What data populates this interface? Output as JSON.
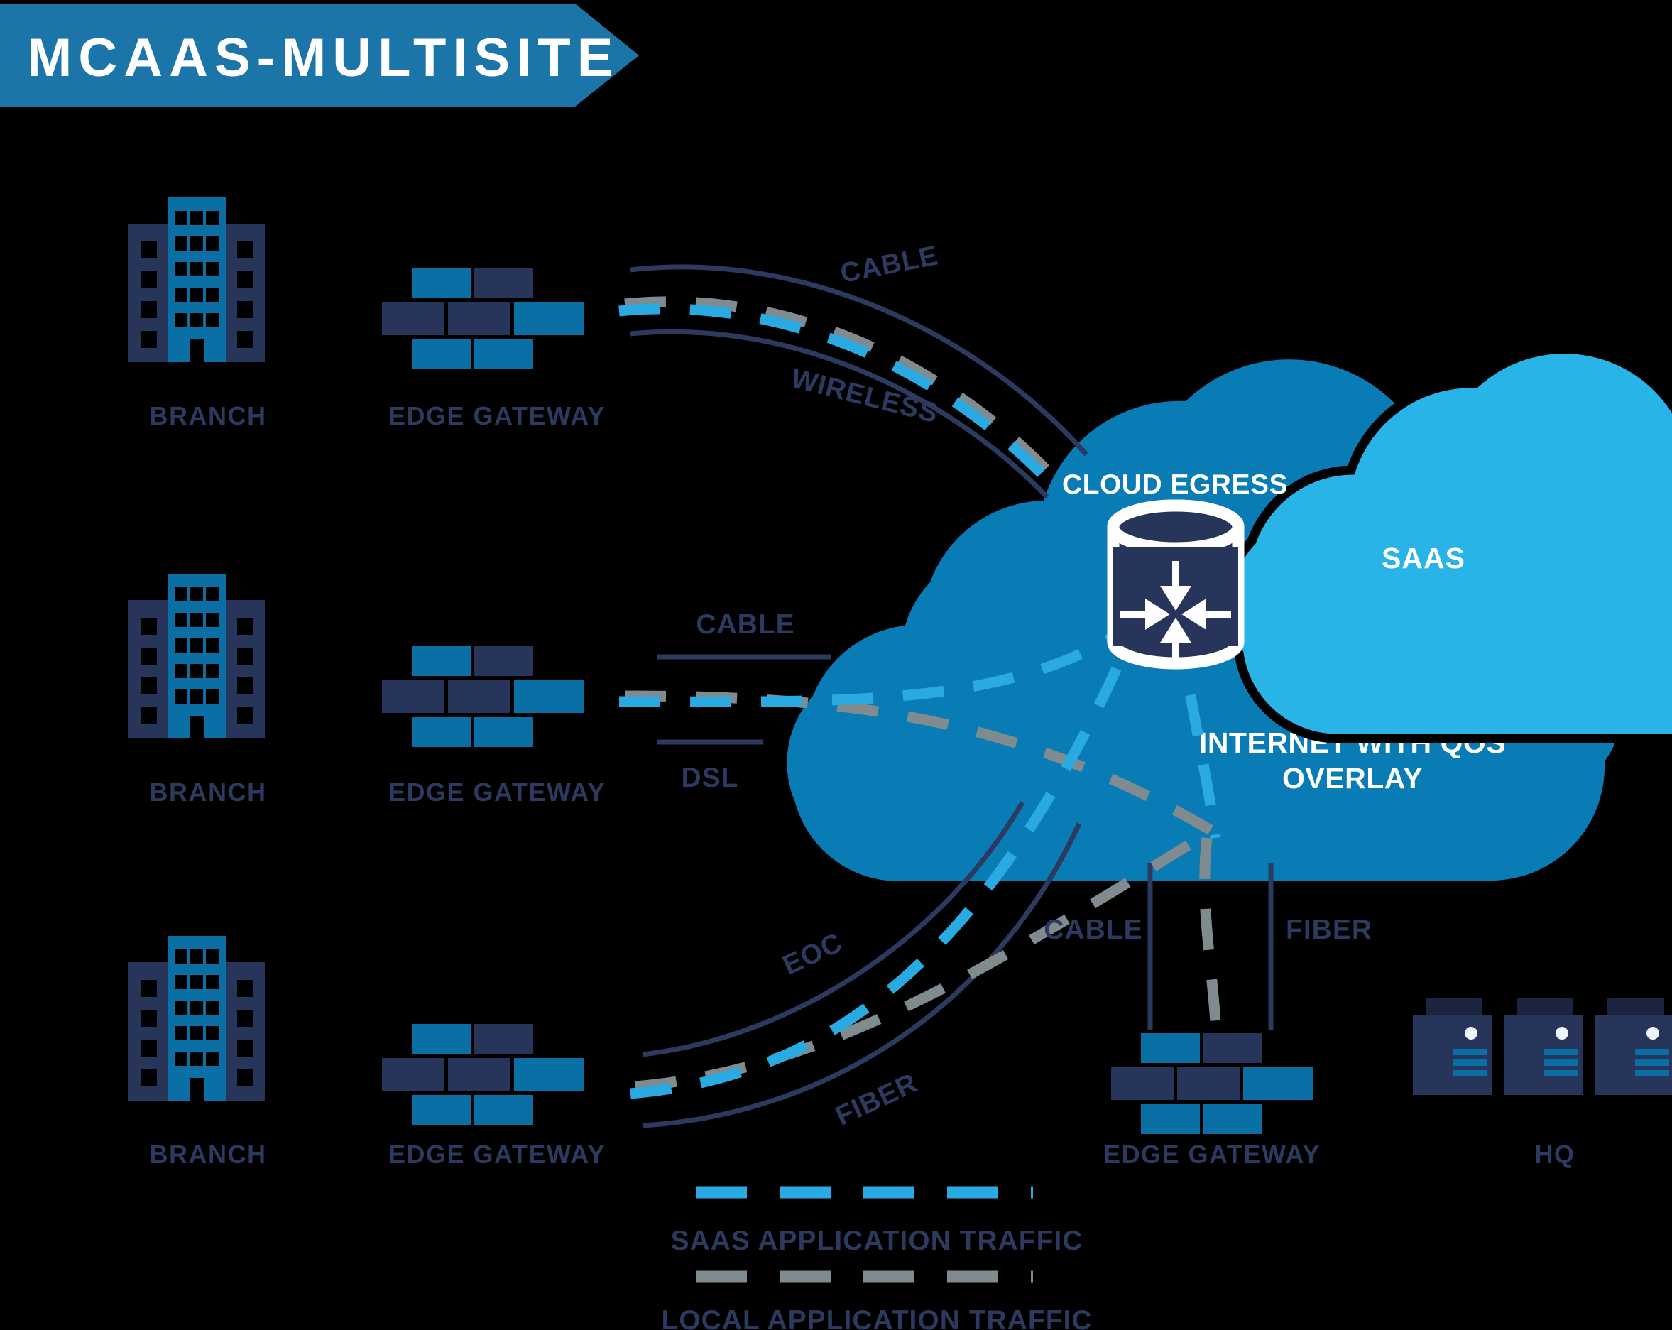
{
  "title_banner": {
    "text": "MCAAS-MULTISITE",
    "bg_color": "#1b75a8",
    "text_color": "#ffffff"
  },
  "colors": {
    "background": "#000000",
    "blue": "#0a6fa4",
    "navy": "#27355a",
    "cyan": "#29aae2",
    "gray": "#7f8b8e",
    "cloud_internet": "#0a7cb5",
    "cloud_saas": "#29b4e8",
    "white": "#ffffff",
    "label_navy": "#2b3a5e"
  },
  "sites": [
    {
      "branch_label": "BRANCH",
      "gateway_label": "EDGE GATEWAY",
      "links": [
        {
          "label": "CABLE",
          "style": "curve"
        },
        {
          "label": "WIRELESS",
          "style": "curve"
        }
      ]
    },
    {
      "branch_label": "BRANCH",
      "gateway_label": "EDGE GATEWAY",
      "links": [
        {
          "label": "CABLE",
          "style": "straight"
        },
        {
          "label": "DSL",
          "style": "straight"
        }
      ]
    },
    {
      "branch_label": "BRANCH",
      "gateway_label": "EDGE GATEWAY",
      "links": [
        {
          "label": "EOC",
          "style": "curve"
        },
        {
          "label": "FIBER",
          "style": "curve"
        }
      ]
    }
  ],
  "hq_site": {
    "gateway_label": "EDGE GATEWAY",
    "hq_label": "HQ",
    "links": [
      {
        "label": "CABLE",
        "style": "vertical"
      },
      {
        "label": "FIBER",
        "style": "vertical"
      }
    ]
  },
  "clouds": {
    "internet": {
      "label_line1": "INTERNET WITH QOS",
      "label_line2": "OVERLAY"
    },
    "saas": {
      "label": "SAAS"
    }
  },
  "cloud_egress": {
    "label": "CLOUD EGRESS",
    "icon": "converge-arrows-cylinder-icon"
  },
  "legend": [
    {
      "label": "SAAS APPLICATION TRAFFIC",
      "color": "#29aae2",
      "dash": "cyan-dashed-line"
    },
    {
      "label": "LOCAL APPLICATION TRAFFIC",
      "color": "#7f8b8e",
      "dash": "gray-dashed-line"
    }
  ]
}
